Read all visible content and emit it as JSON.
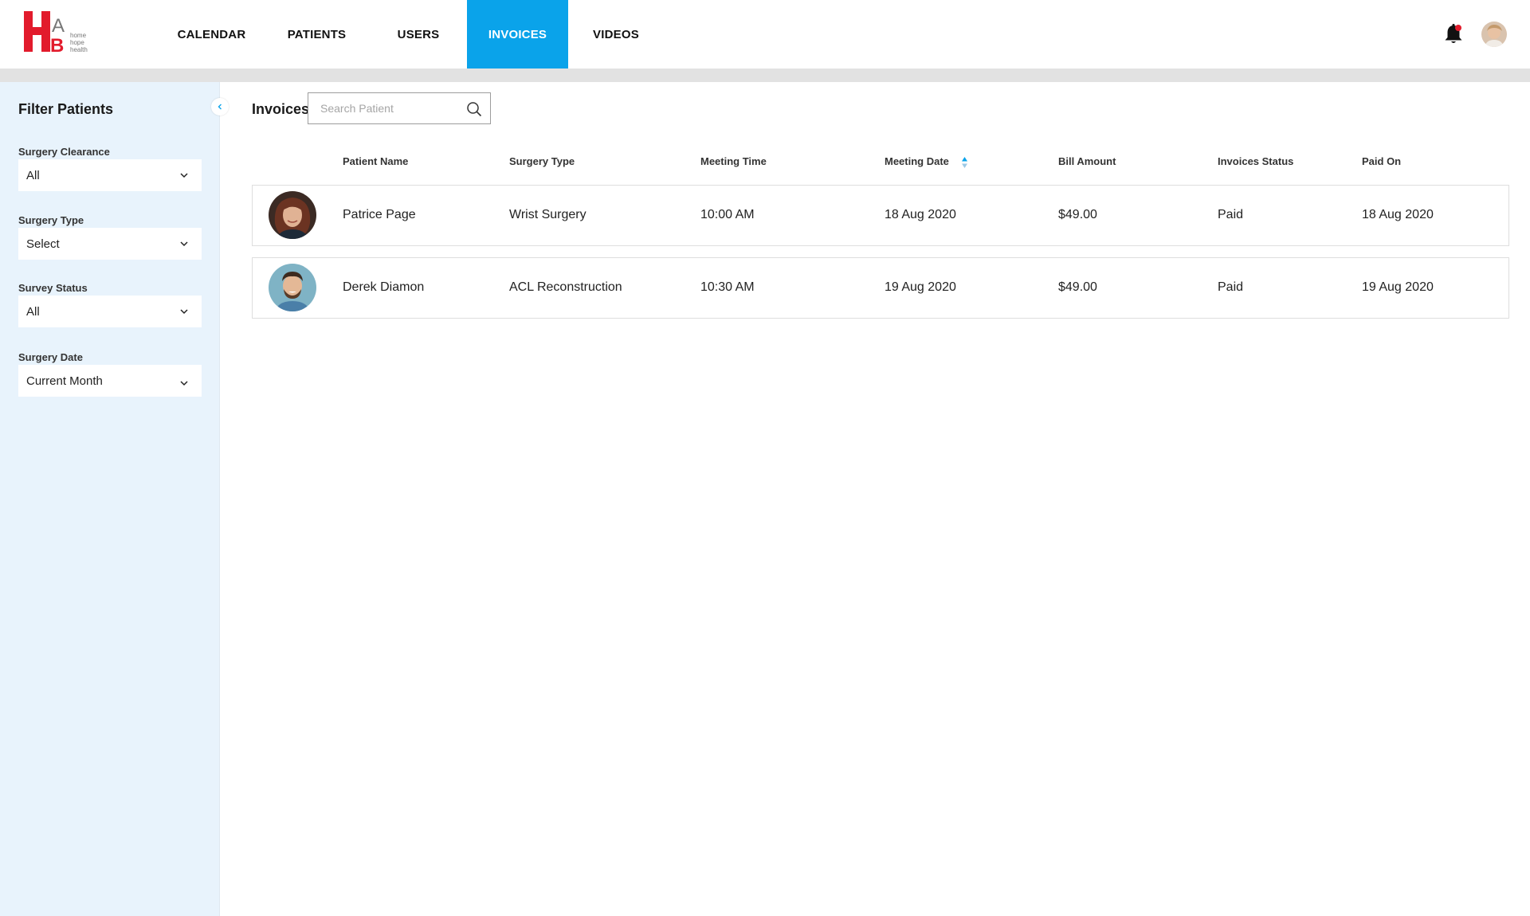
{
  "brand": {
    "logo_letters": "HAB",
    "logo_text": [
      "home",
      "hope",
      "health"
    ]
  },
  "nav": {
    "items": [
      {
        "label": "CALENDAR",
        "active": false
      },
      {
        "label": "PATIENTS",
        "active": false
      },
      {
        "label": "USERS",
        "active": false
      },
      {
        "label": "INVOICES",
        "active": true
      },
      {
        "label": "VIDEOS",
        "active": false
      }
    ]
  },
  "colors": {
    "accent": "#0aa3ea",
    "brand_red": "#e21b2c",
    "sidebar_bg": "#e8f3fc",
    "notification_dot": "#e21b2c"
  },
  "icons": [
    "bell-icon",
    "user-avatar",
    "chevron-left-icon",
    "chevron-down-icon",
    "search-icon",
    "sort-arrows-icon"
  ],
  "sidebar": {
    "title": "Filter Patients",
    "filters": [
      {
        "label": "Surgery Clearance",
        "value": "All"
      },
      {
        "label": "Surgery Type",
        "value": "Select"
      },
      {
        "label": "Survey Status",
        "value": "All"
      },
      {
        "label": "Surgery Date",
        "value": "Current Month"
      }
    ]
  },
  "main": {
    "title": "Invoices",
    "search_placeholder": "Search Patient",
    "columns": [
      "Patient Name",
      "Surgery Type",
      "Meeting Time",
      "Meeting Date",
      "Bill Amount",
      "Invoices Status",
      "Paid On"
    ],
    "sorted_column": "Meeting Date",
    "rows": [
      {
        "name": "Patrice Page",
        "surgery": "Wrist Surgery",
        "time": "10:00 AM",
        "date": "18 Aug 2020",
        "amount": "$49.00",
        "status": "Paid",
        "paid_on": "18 Aug 2020"
      },
      {
        "name": "Derek Diamon",
        "surgery": "ACL Reconstruction",
        "time": "10:30 AM",
        "date": "19 Aug 2020",
        "amount": "$49.00",
        "status": "Paid",
        "paid_on": "19 Aug 2020"
      }
    ]
  }
}
